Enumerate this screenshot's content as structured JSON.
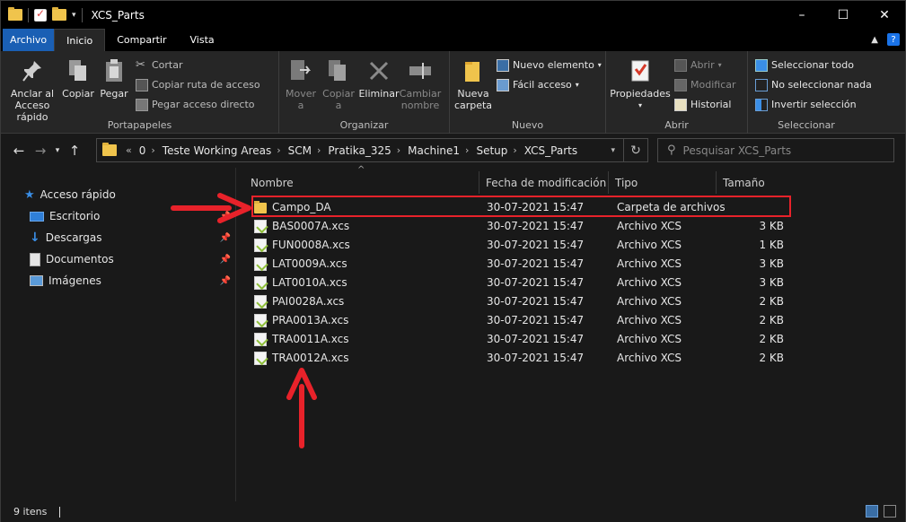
{
  "titlebar": {
    "title": "XCS_Parts"
  },
  "tabs": [
    {
      "label": "Archivo"
    },
    {
      "label": "Inicio"
    },
    {
      "label": "Compartir"
    },
    {
      "label": "Vista"
    }
  ],
  "ribbon": {
    "portapapeles": {
      "label": "Portapapeles",
      "anclar": "Anclar al\nAcceso rápido",
      "copiar": "Copiar",
      "pegar": "Pegar",
      "cortar": "Cortar",
      "copiar_ruta": "Copiar ruta de acceso",
      "pegar_acceso": "Pegar acceso directo"
    },
    "organizar": {
      "label": "Organizar",
      "mover": "Mover\na",
      "copiar_a": "Copiar\na",
      "eliminar": "Eliminar",
      "cambiar": "Cambiar\nnombre"
    },
    "nuevo": {
      "label": "Nuevo",
      "nueva_carpeta": "Nueva\ncarpeta",
      "nuevo_elemento": "Nuevo elemento",
      "facil_acceso": "Fácil acceso"
    },
    "abrir": {
      "label": "Abrir",
      "propiedades": "Propiedades",
      "abrir": "Abrir",
      "modificar": "Modificar",
      "historial": "Historial"
    },
    "seleccionar": {
      "label": "Seleccionar",
      "todo": "Seleccionar todo",
      "nada": "No seleccionar nada",
      "invertir": "Invertir selección"
    }
  },
  "address": {
    "crumbs": [
      "0",
      "Teste Working Areas",
      "SCM",
      "Pratika_325",
      "Machine1",
      "Setup",
      "XCS_Parts"
    ],
    "search_placeholder": "Pesquisar XCS_Parts"
  },
  "navpane": {
    "items": [
      {
        "label": "Acceso rápido"
      },
      {
        "label": "Escritorio"
      },
      {
        "label": "Descargas"
      },
      {
        "label": "Documentos"
      },
      {
        "label": "Imágenes"
      }
    ]
  },
  "columns": {
    "name": "Nombre",
    "date": "Fecha de modificación",
    "type": "Tipo",
    "size": "Tamaño"
  },
  "files": [
    {
      "name": "Campo_DA",
      "date": "30-07-2021 15:47",
      "type": "Carpeta de archivos",
      "size": ""
    },
    {
      "name": "BAS0007A.xcs",
      "date": "30-07-2021 15:47",
      "type": "Archivo XCS",
      "size": "3 KB"
    },
    {
      "name": "FUN0008A.xcs",
      "date": "30-07-2021 15:47",
      "type": "Archivo XCS",
      "size": "1 KB"
    },
    {
      "name": "LAT0009A.xcs",
      "date": "30-07-2021 15:47",
      "type": "Archivo XCS",
      "size": "3 KB"
    },
    {
      "name": "LAT0010A.xcs",
      "date": "30-07-2021 15:47",
      "type": "Archivo XCS",
      "size": "3 KB"
    },
    {
      "name": "PAI0028A.xcs",
      "date": "30-07-2021 15:47",
      "type": "Archivo XCS",
      "size": "2 KB"
    },
    {
      "name": "PRA0013A.xcs",
      "date": "30-07-2021 15:47",
      "type": "Archivo XCS",
      "size": "2 KB"
    },
    {
      "name": "TRA0011A.xcs",
      "date": "30-07-2021 15:47",
      "type": "Archivo XCS",
      "size": "2 KB"
    },
    {
      "name": "TRA0012A.xcs",
      "date": "30-07-2021 15:47",
      "type": "Archivo XCS",
      "size": "2 KB"
    }
  ],
  "status": {
    "items": "9 itens"
  },
  "colors": {
    "annotation": "#e8222a",
    "file_tab": "#1a5fb4",
    "folder": "#f0c44c"
  }
}
